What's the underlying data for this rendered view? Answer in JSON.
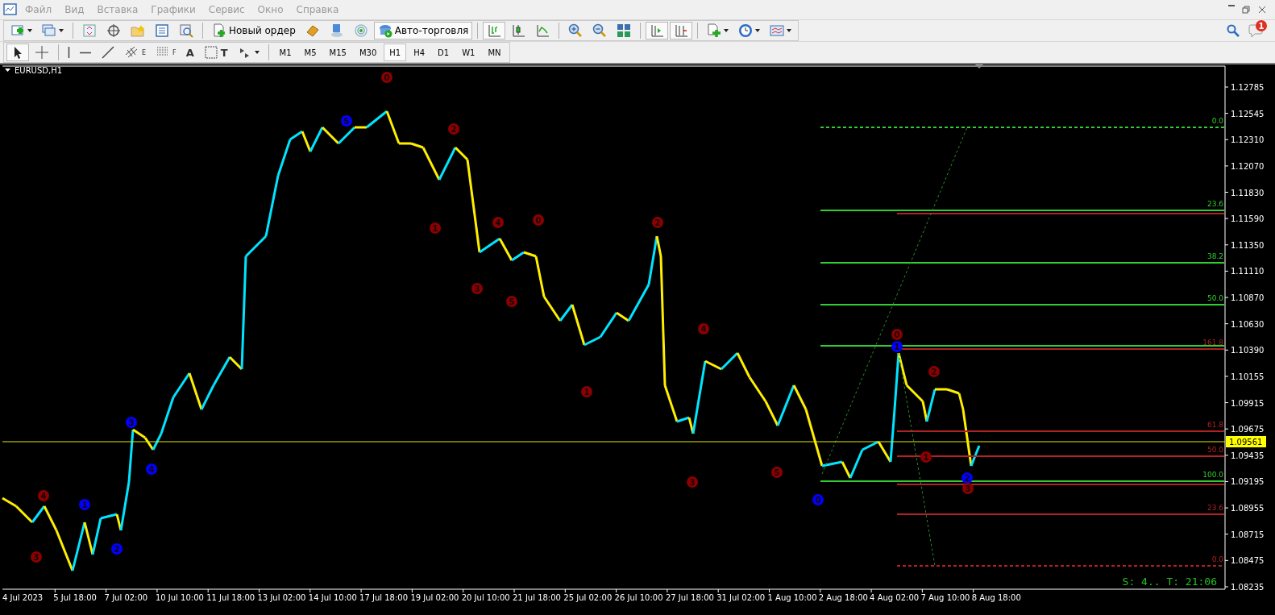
{
  "menu_bar": {
    "items": [
      {
        "label": "Файл",
        "disabled": true
      },
      {
        "label": "Вид",
        "disabled": true
      },
      {
        "label": "Вставка",
        "disabled": true
      },
      {
        "label": "Графики",
        "disabled": true
      },
      {
        "label": "Сервис",
        "disabled": true
      },
      {
        "label": "Окно",
        "disabled": true
      },
      {
        "label": "Справка",
        "disabled": true
      }
    ]
  },
  "toolbar": {
    "items": [
      {
        "kind": "new-chart",
        "pressed": false
      },
      {
        "kind": "profiles",
        "pressed": false
      },
      {
        "kind": "sep"
      },
      {
        "kind": "market-watch",
        "pressed": false
      },
      {
        "kind": "data-window",
        "pressed": false
      },
      {
        "kind": "navigator",
        "pressed": false
      },
      {
        "kind": "terminal",
        "pressed": false
      },
      {
        "kind": "tester",
        "pressed": false
      },
      {
        "kind": "sep"
      },
      {
        "kind": "new-order",
        "label": "Новый ордер",
        "pressed": false
      },
      {
        "kind": "editor",
        "pressed": false
      },
      {
        "kind": "cloud",
        "pressed": false
      },
      {
        "kind": "signal",
        "pressed": false
      },
      {
        "kind": "auto-trading",
        "label": "Авто-торговля",
        "pressed": true
      },
      {
        "kind": "sep"
      },
      {
        "kind": "bar-chart",
        "pressed": true
      },
      {
        "kind": "candles",
        "pressed": false
      },
      {
        "kind": "line-chart",
        "pressed": false
      },
      {
        "kind": "sep"
      },
      {
        "kind": "zoom-in",
        "pressed": false
      },
      {
        "kind": "zoom-out",
        "pressed": false
      },
      {
        "kind": "tile",
        "pressed": false
      },
      {
        "kind": "sep"
      },
      {
        "kind": "autoscroll",
        "pressed": true
      },
      {
        "kind": "chart-shift",
        "pressed": true
      },
      {
        "kind": "sep"
      },
      {
        "kind": "indicators",
        "pressed": false
      },
      {
        "kind": "periods",
        "pressed": false
      },
      {
        "kind": "templates",
        "pressed": false
      }
    ]
  },
  "notifications": {
    "badge": "1"
  },
  "drawing_toolbar": {
    "tools": [
      {
        "kind": "cursor",
        "selected": true
      },
      {
        "kind": "crosshair",
        "selected": false
      },
      {
        "kind": "sep"
      },
      {
        "kind": "vline",
        "selected": false
      },
      {
        "kind": "hline",
        "selected": false
      },
      {
        "kind": "trend",
        "selected": false
      },
      {
        "kind": "channel",
        "glyph": "E",
        "selected": false
      },
      {
        "kind": "fibo",
        "glyph": "F",
        "selected": false
      },
      {
        "kind": "text",
        "glyph": "A",
        "selected": false
      },
      {
        "kind": "label",
        "glyph": "T",
        "selected": false
      },
      {
        "kind": "arrows",
        "selected": false
      }
    ]
  },
  "periods": [
    {
      "label": "M1",
      "selected": false
    },
    {
      "label": "M5",
      "selected": false
    },
    {
      "label": "M15",
      "selected": false
    },
    {
      "label": "M30",
      "selected": false
    },
    {
      "label": "H1",
      "selected": true
    },
    {
      "label": "H4",
      "selected": false
    },
    {
      "label": "D1",
      "selected": false
    },
    {
      "label": "W1",
      "selected": false
    },
    {
      "label": "MN",
      "selected": false
    }
  ],
  "chart": {
    "symbol": "EURUSD,H1",
    "price_labels": [
      "1.12785",
      "1.12545",
      "1.12310",
      "1.12070",
      "1.11830",
      "1.11590",
      "1.11350",
      "1.11110",
      "1.10870",
      "1.10630",
      "1.10390",
      "1.10155",
      "1.09915",
      "1.09675",
      "1.09435",
      "1.09195",
      "1.08955",
      "1.08715",
      "1.08475",
      "1.08235"
    ],
    "current_price": "1.09561",
    "time_labels": [
      "4 Jul 2023",
      "5 Jul 18:00",
      "7 Jul 02:00",
      "10 Jul 10:00",
      "11 Jul 18:00",
      "13 Jul 02:00",
      "14 Jul 10:00",
      "17 Jul 18:00",
      "19 Jul 02:00",
      "20 Jul 10:00",
      "21 Jul 18:00",
      "25 Jul 02:00",
      "26 Jul 10:00",
      "27 Jul 18:00",
      "31 Jul 02:00",
      "1 Aug 10:00",
      "2 Aug 18:00",
      "4 Aug 02:00",
      "7 Aug 10:00",
      "8 Aug 18:00"
    ],
    "fibo_levels": [
      {
        "label": "0.0",
        "color": "#32cd32",
        "kind": "dashed"
      },
      {
        "label": "23.6",
        "color": "#32cd32",
        "kind": "solid"
      },
      {
        "color": "#b22222",
        "kind": "solid"
      },
      {
        "label": "38.2",
        "color": "#32cd32",
        "kind": "solid"
      },
      {
        "label": "50.0",
        "color": "#32cd32",
        "kind": "solid"
      },
      {
        "color": "#32cd32",
        "kind": "solid"
      },
      {
        "label": "161.8",
        "color": "#b22222",
        "kind": "solid"
      },
      {
        "label": "61.8",
        "color": "#b22222",
        "kind": "solid"
      },
      {
        "label": "50.0",
        "color": "#b22222",
        "kind": "solid"
      },
      {
        "label": "100.0",
        "color": "#32cd32",
        "kind": "solid"
      },
      {
        "color": "#b22222",
        "kind": "solid"
      },
      {
        "label": "23.6",
        "color": "#b22222",
        "kind": "solid"
      },
      {
        "label": "0.0",
        "color": "#b22222",
        "kind": "dashed"
      }
    ],
    "wave_markers": [
      {
        "label": "4",
        "color": "#8b0000"
      },
      {
        "label": "3",
        "color": "#8b0000"
      },
      {
        "label": "1",
        "color": "#0000ff"
      },
      {
        "label": "2",
        "color": "#0000ff"
      },
      {
        "label": "3",
        "color": "#0000ff"
      },
      {
        "label": "4",
        "color": "#0000ff"
      },
      {
        "label": "5",
        "color": "#0000ff"
      },
      {
        "label": "0",
        "color": "#8b0000"
      },
      {
        "label": "1",
        "color": "#8b0000"
      },
      {
        "label": "2",
        "color": "#8b0000"
      },
      {
        "label": "3",
        "color": "#8b0000"
      },
      {
        "label": "4",
        "color": "#8b0000"
      },
      {
        "label": "5",
        "color": "#8b0000"
      },
      {
        "label": "0",
        "color": "#8b0000"
      },
      {
        "label": "1",
        "color": "#8b0000"
      },
      {
        "label": "2",
        "color": "#8b0000"
      },
      {
        "label": "3",
        "color": "#8b0000"
      },
      {
        "label": "4",
        "color": "#8b0000"
      },
      {
        "label": "5",
        "color": "#8b0000"
      },
      {
        "label": "0",
        "color": "#0000ff"
      },
      {
        "label": "0",
        "color": "#8b0000"
      },
      {
        "label": "1",
        "color": "#0000ff"
      },
      {
        "label": "2",
        "color": "#8b0000"
      },
      {
        "label": "1",
        "color": "#8b0000"
      },
      {
        "label": "2",
        "color": "#0000ff"
      },
      {
        "label": "3",
        "color": "#8b0000"
      }
    ],
    "status": "S: 4.. T: 21:06"
  }
}
